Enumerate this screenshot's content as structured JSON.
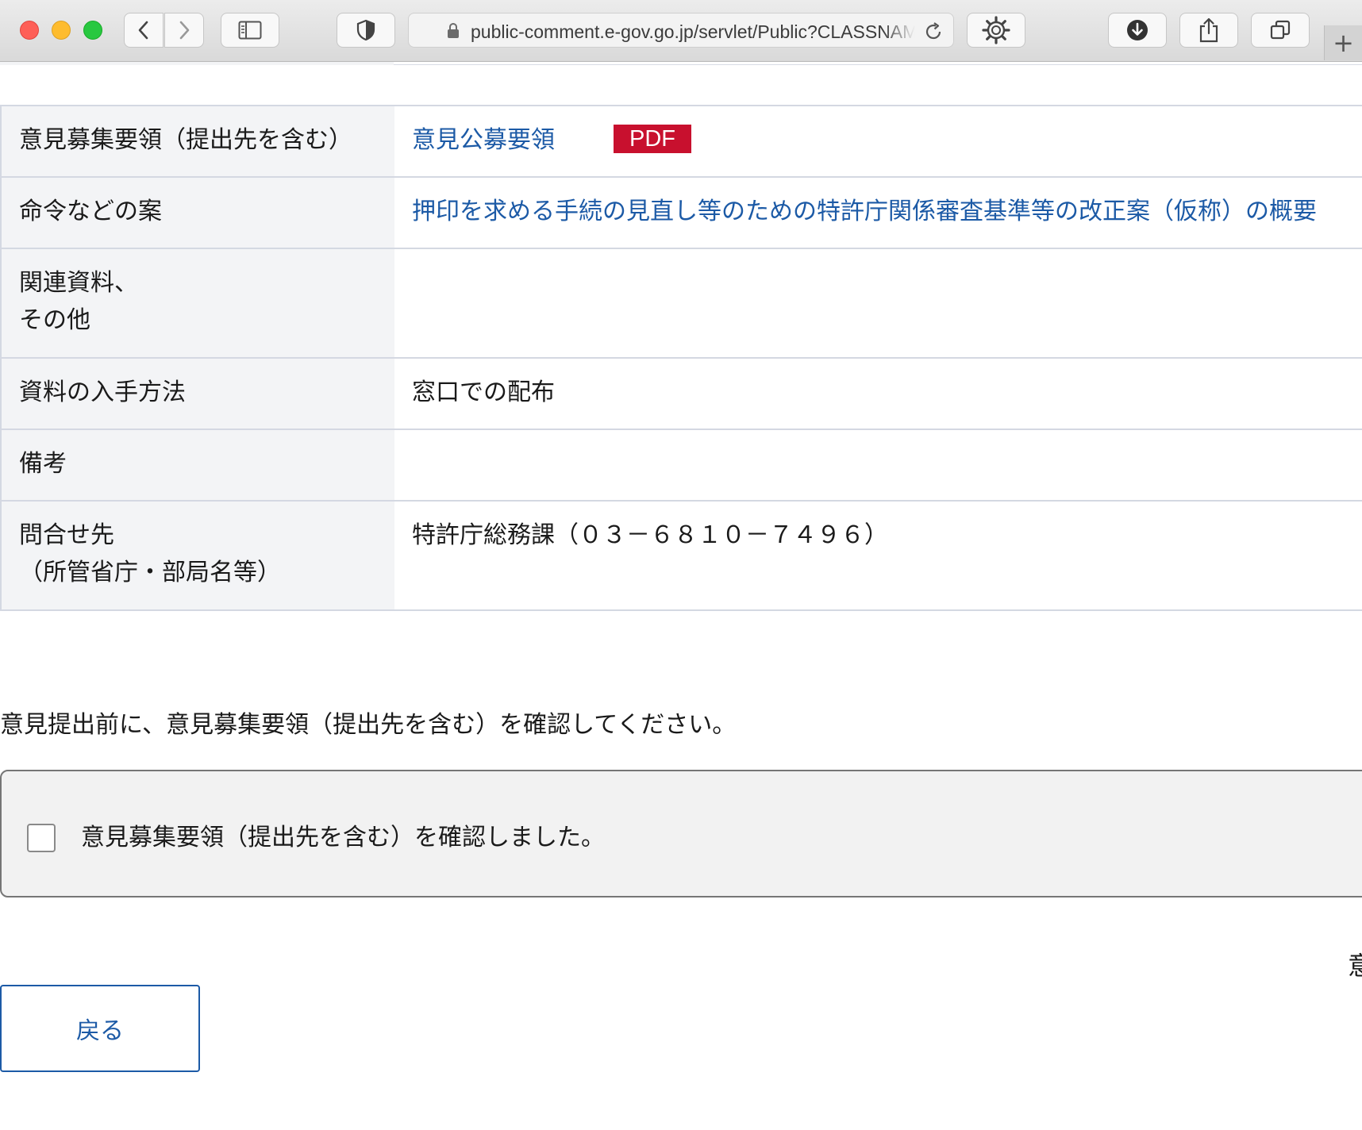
{
  "browser": {
    "url": "public-comment.e-gov.go.jp/servlet/Public?CLASSNAME=PCMMSTDETAIL",
    "new_tab_symbol": "+"
  },
  "table": {
    "rows": [
      {
        "label": "意見募集要領（提出先を含む）",
        "value": "意見公募要領",
        "badge": "PDF"
      },
      {
        "label": "命令などの案",
        "value": "押印を求める手続の見直し等のための特許庁関係審査基準等の改正案（仮称）の概要"
      },
      {
        "label_line1": "関連資料、",
        "label_line2": "その他",
        "value": ""
      },
      {
        "label": "資料の入手方法",
        "value": "窓口での配布"
      },
      {
        "label": "備考",
        "value": ""
      },
      {
        "label_line1": "問合せ先",
        "label_line2": "（所管省庁・部局名等）",
        "value": "特許庁総務課（０３－６８１０－７４９６）"
      }
    ]
  },
  "notice_text": "意見提出前に、意見募集要領（提出先を含む）を確認してください。",
  "confirm": {
    "label": "意見募集要領（提出先を含む）を確認しました。",
    "checked": false
  },
  "edge_char": "意",
  "back_button": "戻る",
  "colors": {
    "link": "#1c5aa6",
    "pdf_badge": "#c8102e",
    "label_cell_bg": "#f3f4f6"
  }
}
